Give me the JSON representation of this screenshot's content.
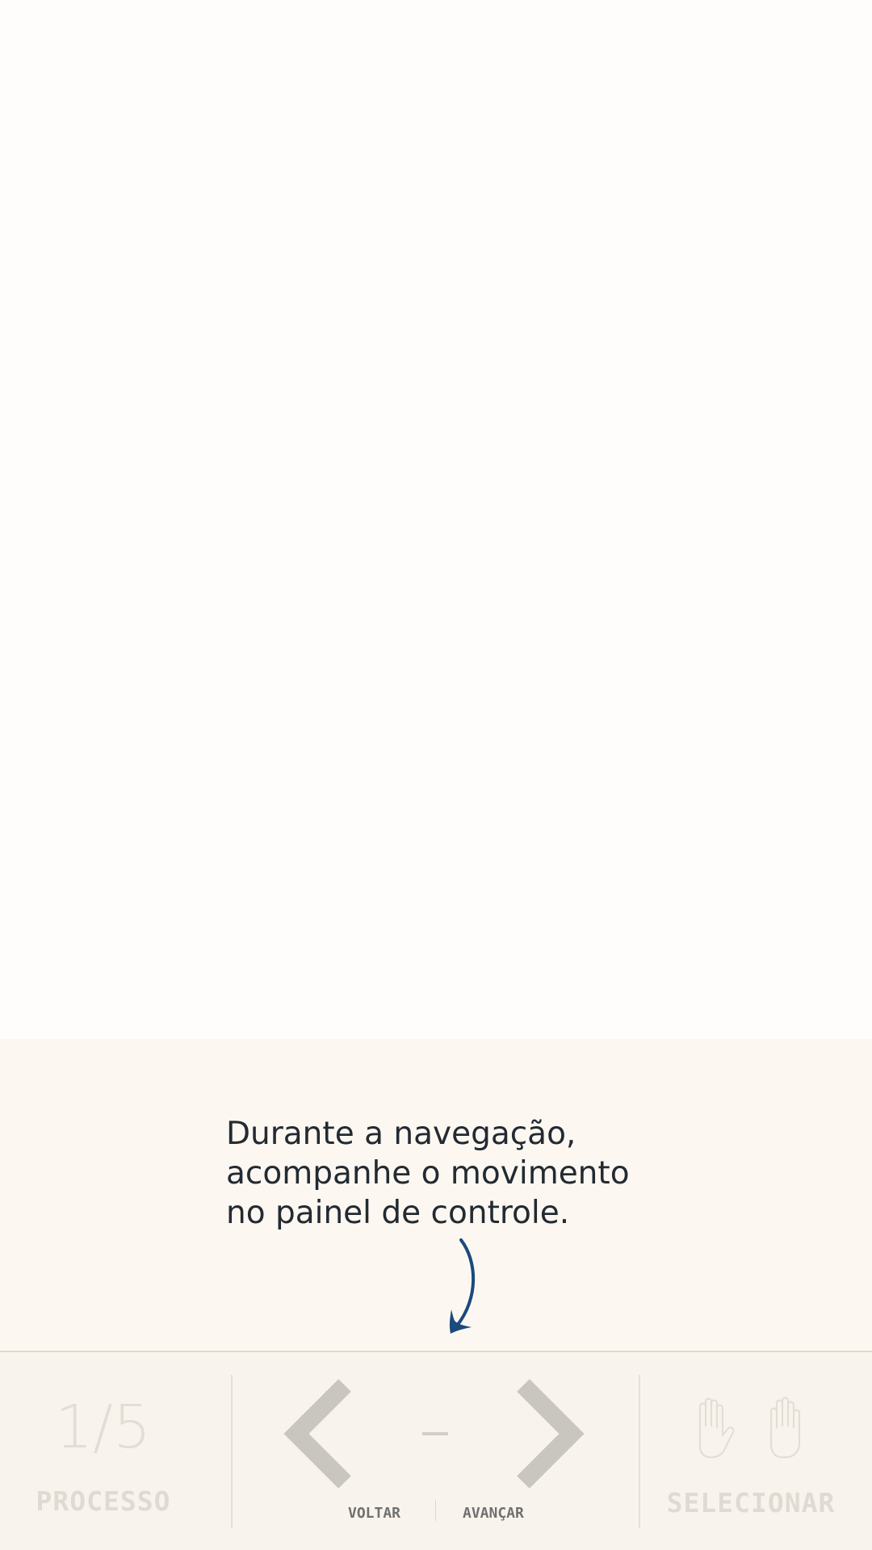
{
  "hint": {
    "text": "Durante a navegação,\nacompanhe o movimento\nno painel de controle."
  },
  "process": {
    "counter": "1/5",
    "label": "PROCESSO"
  },
  "navigation": {
    "back_icon": "chevron-left-icon",
    "forward_icon": "chevron-right-icon",
    "current": "–",
    "back_label": "VOLTAR",
    "forward_label": "AVANÇAR"
  },
  "select": {
    "label": "SELECIONAR",
    "icons": [
      "hand-left-icon",
      "hand-right-icon"
    ]
  },
  "colors": {
    "hint_background": "#fcf8f1",
    "panel_background": "#f8f4ed",
    "arrow": "#1b4a7c",
    "text": "#232a32",
    "inactive": "#d2cec6"
  }
}
